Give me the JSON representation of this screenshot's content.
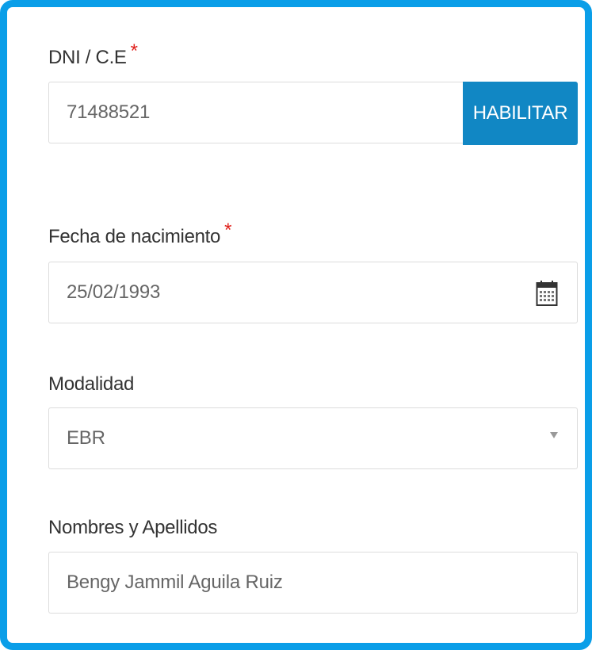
{
  "form": {
    "dni": {
      "label": "DNI / C.E",
      "required_mark": "*",
      "value": "71488521",
      "button_label": "HABILITAR"
    },
    "birthdate": {
      "label": "Fecha de nacimiento",
      "required_mark": "*",
      "value": "25/02/1993",
      "icon": "calendar-icon"
    },
    "modalidad": {
      "label": "Modalidad",
      "selected": "EBR",
      "icon": "dropdown-caret-icon"
    },
    "nombres": {
      "label": "Nombres y Apellidos",
      "value": "Bengy Jammil Aguila Ruiz"
    }
  },
  "colors": {
    "frame_border": "#0a9ee8",
    "button_bg": "#1187c4",
    "required": "#e0201b"
  }
}
